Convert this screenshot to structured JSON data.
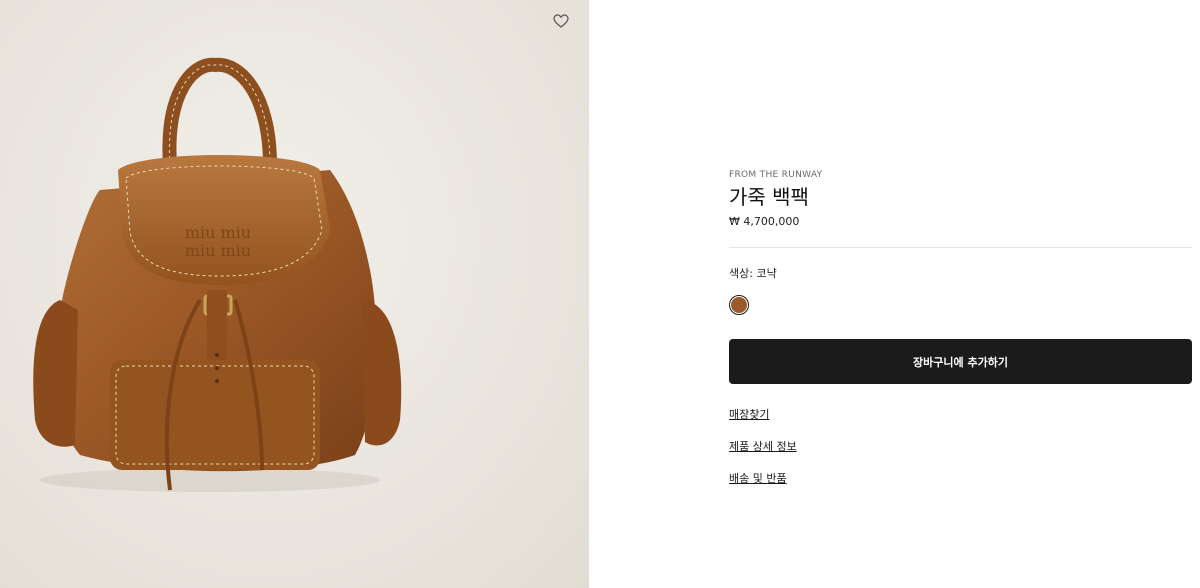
{
  "product": {
    "eyebrow": "FROM THE RUNWAY",
    "title": "가죽 백팩",
    "price": "₩ 4,700,000",
    "color_label": "색상:",
    "color_value": "코냑",
    "swatch_color": "#9c5a2a",
    "logo_text": "miu miu"
  },
  "actions": {
    "add_to_cart": "장바구니에 추가하기",
    "wishlist_icon": "heart-icon"
  },
  "links": [
    "매장찾기",
    "제품 상세 정보",
    "배송 및 반품"
  ],
  "colors": {
    "image_background": "#ebe7e0",
    "button_background": "#1b1b1b",
    "leather": "#9c5a2a"
  }
}
